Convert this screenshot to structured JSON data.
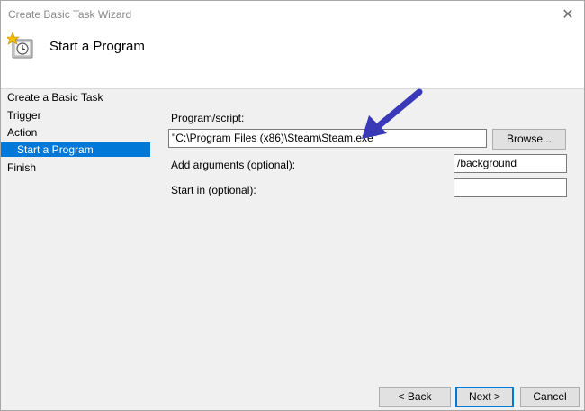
{
  "window": {
    "title": "Create Basic Task Wizard",
    "close_glyph": "✕"
  },
  "header": {
    "title": "Start a Program",
    "icon": "task-scheduler-clock-icon"
  },
  "sidebar": {
    "items": [
      {
        "label": "Create a Basic Task",
        "selected": false
      },
      {
        "label": "Trigger",
        "selected": false
      },
      {
        "label": "Action",
        "selected": false
      },
      {
        "label": "Start a Program",
        "selected": true
      },
      {
        "label": "Finish",
        "selected": false
      }
    ]
  },
  "form": {
    "program_label": "Program/script:",
    "program_value": "\"C:\\Program Files (x86)\\Steam\\Steam.exe\"",
    "browse_label": "Browse...",
    "arguments_label": "Add arguments (optional):",
    "arguments_value": "/background",
    "start_in_label": "Start in (optional):",
    "start_in_value": ""
  },
  "footer": {
    "back_label": "< Back",
    "next_label": "Next >",
    "cancel_label": "Cancel"
  },
  "colors": {
    "selection": "#0078d7",
    "annotation_arrow": "#3a3ab8"
  }
}
